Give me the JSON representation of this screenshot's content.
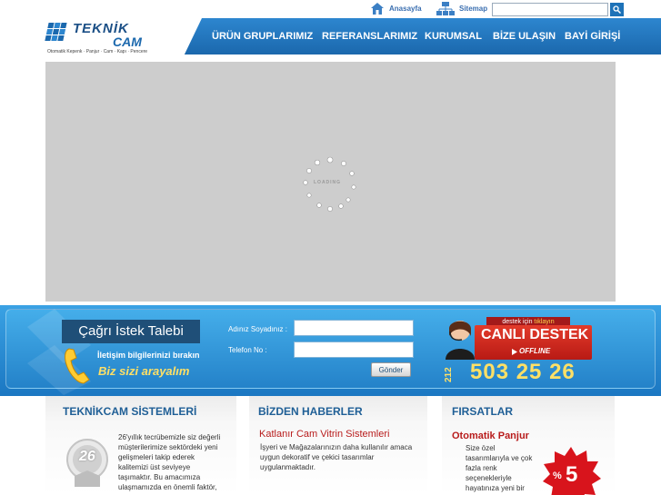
{
  "top_links": {
    "home": "Anasayfa",
    "sitemap": "Sitemap"
  },
  "search": {
    "value": "",
    "placeholder": ""
  },
  "logo": {
    "name_line1": "TEKNİK",
    "name_line2": "CAM",
    "tagline": "Otomatik Kepenk · Panjur · Cam · Kapı · Pencere"
  },
  "nav": {
    "items": [
      {
        "label": "ÜRÜN GRUPLARIMIZ"
      },
      {
        "label": "REFERANSLARIMIZ"
      },
      {
        "label": "KURUMSAL"
      },
      {
        "label": "BİZE ULAŞIN"
      },
      {
        "label": "BAYİ GİRİŞİ"
      }
    ]
  },
  "slider": {
    "loading_text": "LOADING"
  },
  "callback": {
    "title": "Çağrı İstek Talebi",
    "subtitle": "İletişim bilgilerinizi bırakın",
    "tagline": "Biz sizi arayalım",
    "name_label": "Adınız Soyadınız :",
    "phone_label": "Telefon No :",
    "name_value": "",
    "phone_value": "",
    "send_label": "Gönder"
  },
  "support": {
    "top_text": "destek için",
    "top_highlight": "tıklayın",
    "title": "CANLI DESTEK",
    "status": "OFFLINE",
    "phone_prefix": "212",
    "phone_number": "503 25 26"
  },
  "columns": {
    "systems": {
      "title": "TEKNİKCAM SİSTEMLERİ",
      "badge_years": "26",
      "text": "26'yıllık tecrübemizle siz değerli müşterilerimize sektördeki yeni gelişmeleri takip ederek kalitemizi üst seviyeye taşımaktır. Bu amacımıza ulaşmamızda en önemli faktör,"
    },
    "news": {
      "title": "BİZDEN HABERLER",
      "item_title": "Katlanır Cam Vitrin Sistemleri",
      "item_text": "İşyeri ve Mağazalarınızın daha kullanılır amaca uygun dekoratif ve çekici tasarımlar uygulanmaktadır."
    },
    "offers": {
      "title": "FIRSATLAR",
      "item_title": "Otomatik Panjur",
      "item_text": "Size özel tasarımlarıyla ve çok fazla renk seçenekleriyle hayatınıza yeni bir",
      "discount": "5",
      "discount_symbol": "%"
    }
  },
  "colors": {
    "nav_blue": "#1b68ad",
    "band_blue": "#2482c9",
    "accent_red": "#b81c1c",
    "highlight_yellow": "#ffe066"
  }
}
